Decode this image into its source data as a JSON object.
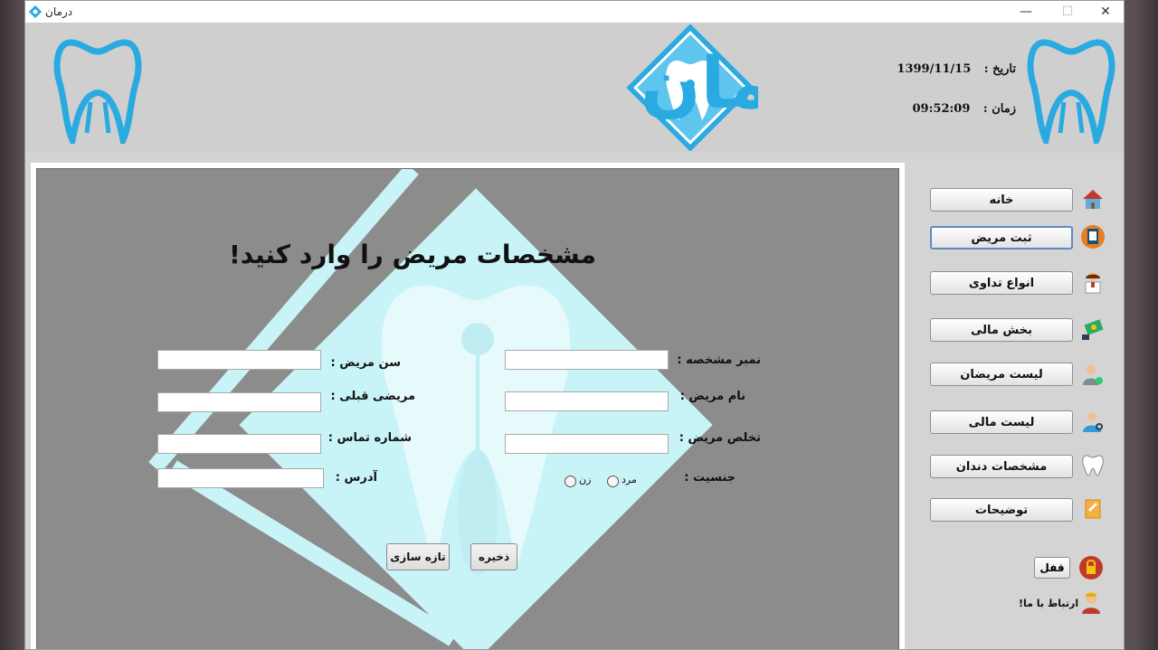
{
  "window": {
    "title": "درمان"
  },
  "header": {
    "logo_text": "درمان",
    "date_label": "تاریخ :",
    "date_value": "1399/11/15",
    "time_label": "زمان :",
    "time_value": "09:52:09"
  },
  "form": {
    "title": "مشخصات مریض را وارد کنید!",
    "fields": {
      "id_label": "نمبر مشخصه :",
      "name_label": "نام مریض :",
      "surname_label": "تخلص مریض :",
      "gender_label": "جنسیت :",
      "age_label": "سن مریض :",
      "previous_label": "مریضی قبلی :",
      "phone_label": "شماره تماس :",
      "address_label": "آدرس :"
    },
    "gender_options": {
      "male": "مرد",
      "female": "زن"
    },
    "values": {
      "id": "",
      "name": "",
      "surname": "",
      "age": "",
      "previous": "",
      "phone": "",
      "address": ""
    },
    "save_label": "ذخیره",
    "refresh_label": "تازه سازی"
  },
  "sidebar": {
    "items": [
      {
        "label": "خانه",
        "icon": "home-icon"
      },
      {
        "label": "ثبت مریض",
        "icon": "clipboard-icon"
      },
      {
        "label": "انواع تداوی",
        "icon": "doctor-icon"
      },
      {
        "label": "بخش مالی",
        "icon": "money-icon"
      },
      {
        "label": "لیست مریضان",
        "icon": "patients-icon"
      },
      {
        "label": "لیست مالی",
        "icon": "user-search-icon"
      },
      {
        "label": "مشخصات دندان",
        "icon": "tooth-icon"
      },
      {
        "label": "توضیحات",
        "icon": "notes-icon"
      }
    ],
    "lock_label": "قفل",
    "contact_label": "ارتباط با ما!"
  },
  "colors": {
    "accent": "#29aae1",
    "panel_bg": "#8c8c8c",
    "diamond": "#c8f4f8"
  }
}
